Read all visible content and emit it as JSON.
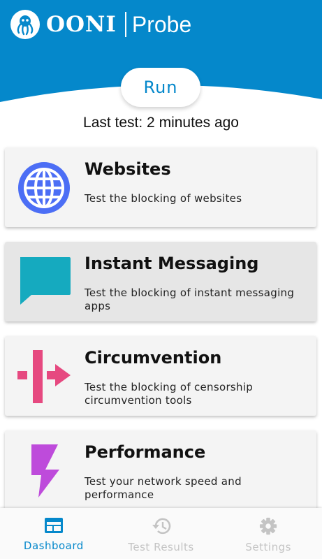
{
  "colors": {
    "brand_blue": "#0588cb",
    "websites": "#4c6ef5",
    "instant_messaging": "#15aabf",
    "circumvention": "#e64980",
    "performance": "#be4bdb",
    "nav_inactive": "#c4c4c4"
  },
  "header": {
    "logo_name": "OONI",
    "logo_product": "Probe",
    "logo_icon": "octopus-icon"
  },
  "run_button": {
    "label": "Run"
  },
  "last_test": "Last test: 2 minutes ago",
  "cards": [
    {
      "icon": "globe-icon",
      "title": "Websites",
      "description": "Test the blocking of websites"
    },
    {
      "icon": "chat-bubble-icon",
      "title": "Instant Messaging",
      "description": "Test the blocking of instant messaging apps"
    },
    {
      "icon": "circumvention-arrow-icon",
      "title": "Circumvention",
      "description": "Test the blocking of censorship circumvention tools"
    },
    {
      "icon": "lightning-icon",
      "title": "Performance",
      "description": "Test your network speed and performance"
    }
  ],
  "bottom_nav": [
    {
      "icon": "dashboard-icon",
      "label": "Dashboard",
      "active": true
    },
    {
      "icon": "history-icon",
      "label": "Test Results",
      "active": false
    },
    {
      "icon": "gear-icon",
      "label": "Settings",
      "active": false
    }
  ]
}
